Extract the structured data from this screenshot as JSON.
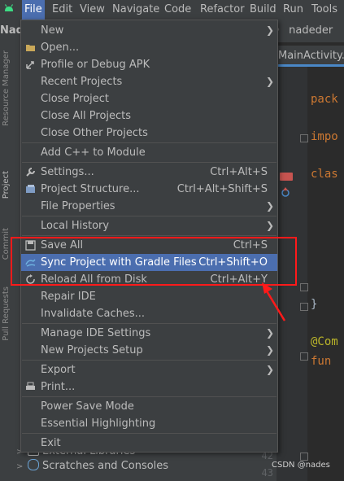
{
  "menubar": {
    "items": [
      "File",
      "Edit",
      "View",
      "Navigate",
      "Code",
      "Refactor",
      "Build",
      "Run",
      "Tools"
    ],
    "active": "File"
  },
  "toolstrip": {
    "project_name": "Nade",
    "breadcrumb_tail": "nadeder"
  },
  "editor": {
    "tab_label": "MainActivity.kt",
    "code_lines": [
      {
        "text": "pack",
        "style": "kw"
      },
      {
        "text": "impo",
        "style": "kw"
      },
      {
        "text": "clas",
        "style": "kw"
      },
      {
        "text": "}",
        "style": "brace"
      },
      {
        "text": "@Com",
        "style": "ann"
      },
      {
        "text": "fun",
        "style": "kw"
      }
    ],
    "line_numbers": [
      "42",
      "43"
    ]
  },
  "side_strip": {
    "labels": [
      "Resource Manager",
      "Project",
      "Commit",
      "Pull Requests"
    ]
  },
  "project_tree": {
    "items": [
      "External Libraries",
      "Scratches and Consoles"
    ]
  },
  "file_menu": {
    "items": [
      {
        "label": "New",
        "submenu": true
      },
      {
        "label": "Open...",
        "icon": "folder-icon"
      },
      {
        "label": "Profile or Debug APK",
        "icon": "profile-icon"
      },
      {
        "label": "Recent Projects",
        "submenu": true
      },
      {
        "label": "Close Project"
      },
      {
        "label": "Close All Projects"
      },
      {
        "label": "Close Other Projects"
      },
      {
        "separator": true
      },
      {
        "label": "Add C++ to Module"
      },
      {
        "separator": true
      },
      {
        "label": "Settings...",
        "shortcut": "Ctrl+Alt+S",
        "icon": "wrench-icon"
      },
      {
        "label": "Project Structure...",
        "shortcut": "Ctrl+Alt+Shift+S",
        "icon": "project-structure-icon"
      },
      {
        "label": "File Properties",
        "submenu": true
      },
      {
        "separator": true
      },
      {
        "label": "Local History",
        "submenu": true
      },
      {
        "separator": true
      },
      {
        "label": "Save All",
        "shortcut": "Ctrl+S",
        "icon": "save-icon"
      },
      {
        "label": "Sync Project with Gradle Files",
        "shortcut": "Ctrl+Shift+O",
        "icon": "gradle-sync-icon",
        "highlighted": true
      },
      {
        "label": "Reload All from Disk",
        "shortcut": "Ctrl+Alt+Y",
        "icon": "reload-icon"
      },
      {
        "label": "Repair IDE"
      },
      {
        "label": "Invalidate Caches..."
      },
      {
        "separator": true
      },
      {
        "label": "Manage IDE Settings",
        "submenu": true
      },
      {
        "label": "New Projects Setup",
        "submenu": true
      },
      {
        "separator": true
      },
      {
        "label": "Export",
        "submenu": true
      },
      {
        "label": "Print...",
        "icon": "print-icon"
      },
      {
        "separator": true
      },
      {
        "label": "Power Save Mode"
      },
      {
        "label": "Essential Highlighting"
      },
      {
        "separator": true
      },
      {
        "label": "Exit"
      }
    ]
  },
  "watermark": "CSDN @nades",
  "colors": {
    "menu_bg": "#3c3f41",
    "highlight": "#4b6eaf",
    "annotation_red": "#ff1a1a",
    "keyword": "#cc7832"
  }
}
